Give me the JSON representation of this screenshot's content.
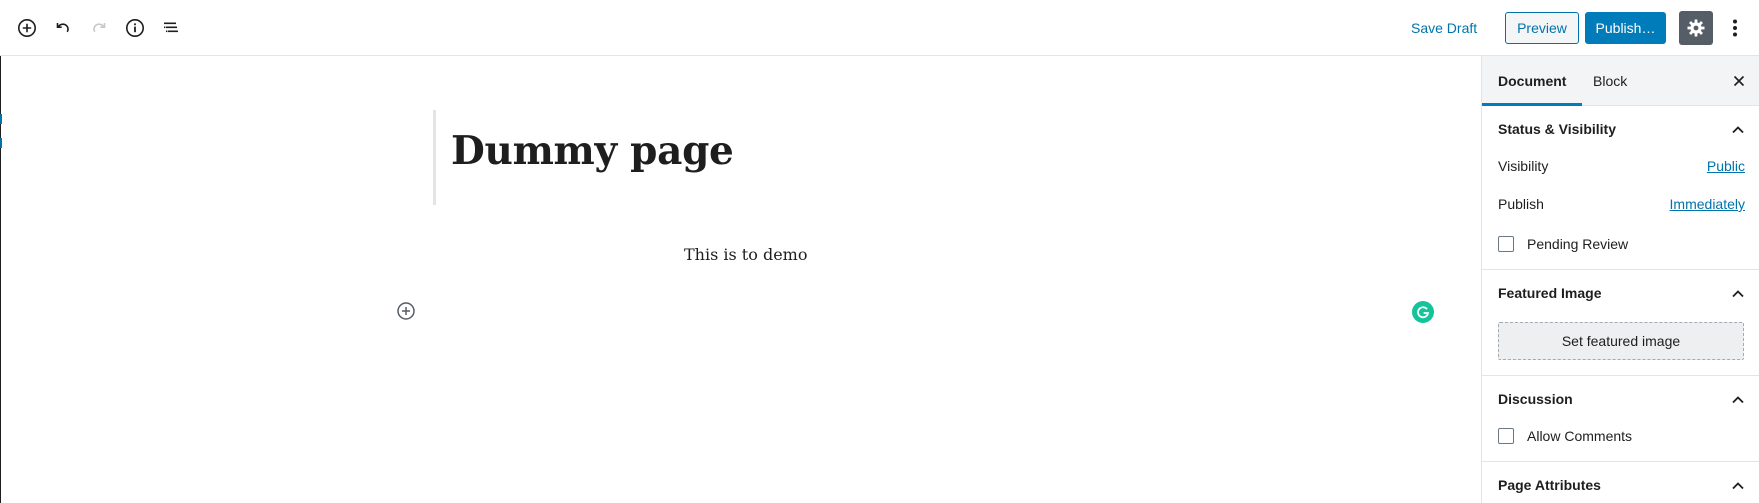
{
  "toolbar": {
    "left_icons": [
      "add-block-icon",
      "undo-icon",
      "redo-icon",
      "info-icon",
      "block-navigation-icon"
    ],
    "save_draft": "Save Draft",
    "preview": "Preview",
    "publish": "Publish…",
    "accent_color": "#007cba"
  },
  "editor": {
    "title": "Dummy page",
    "paragraph": "This is to demo"
  },
  "sidebar": {
    "tabs": [
      {
        "label": "Document",
        "active": true
      },
      {
        "label": "Block",
        "active": false
      }
    ],
    "status_visibility": {
      "heading": "Status & Visibility",
      "visibility_label": "Visibility",
      "visibility_value": "Public",
      "publish_label": "Publish",
      "publish_value": "Immediately",
      "pending_review": "Pending Review"
    },
    "featured_image": {
      "heading": "Featured Image",
      "button": "Set featured image"
    },
    "discussion": {
      "heading": "Discussion",
      "allow_comments": "Allow Comments"
    },
    "page_attributes": {
      "heading": "Page Attributes"
    }
  }
}
